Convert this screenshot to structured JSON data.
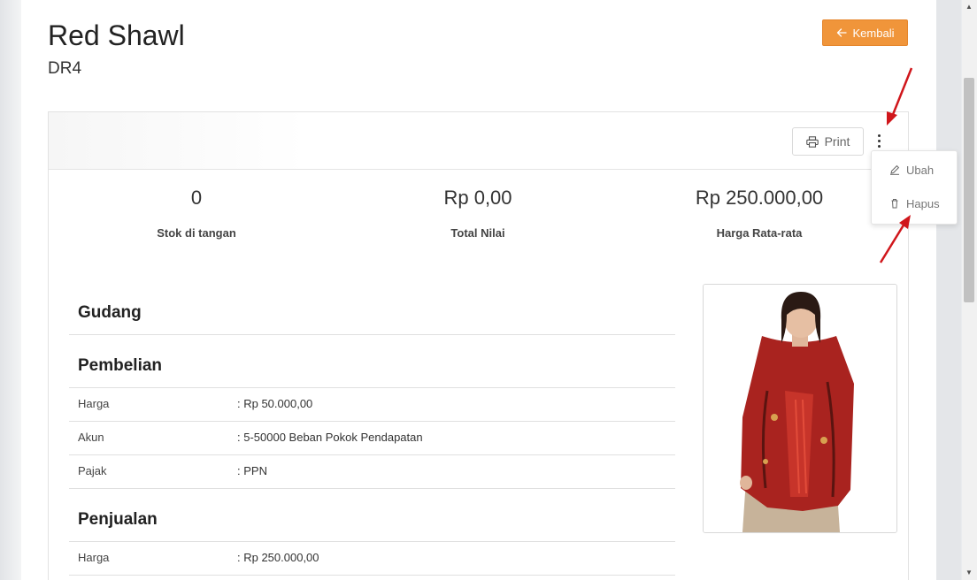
{
  "header": {
    "title": "Red Shawl",
    "code": "DR4",
    "back_label": "Kembali"
  },
  "toolbar": {
    "print_label": "Print",
    "menu_icon": "more-vertical-icon"
  },
  "dropdown_menu": {
    "items": [
      {
        "label": "Ubah",
        "icon": "pencil-icon"
      },
      {
        "label": "Hapus",
        "icon": "trash-icon"
      }
    ]
  },
  "stats": [
    {
      "value": "0",
      "label": "Stok di tangan"
    },
    {
      "value": "Rp 0,00",
      "label": "Total Nilai"
    },
    {
      "value": "Rp 250.000,00",
      "label": "Harga Rata-rata"
    }
  ],
  "sections": {
    "warehouse": {
      "title": "Gudang"
    },
    "purchase": {
      "title": "Pembelian",
      "rows": [
        {
          "label": "Harga",
          "value": ": Rp 50.000,00"
        },
        {
          "label": "Akun",
          "value": ": 5-50000 Beban Pokok Pendapatan"
        },
        {
          "label": "Pajak",
          "value": ": PPN"
        }
      ]
    },
    "sales": {
      "title": "Penjualan",
      "rows": [
        {
          "label": "Harga",
          "value": ": Rp 250.000,00"
        }
      ]
    }
  },
  "colors": {
    "accent": "#f0953a",
    "annotation_arrow": "#d0161b"
  }
}
